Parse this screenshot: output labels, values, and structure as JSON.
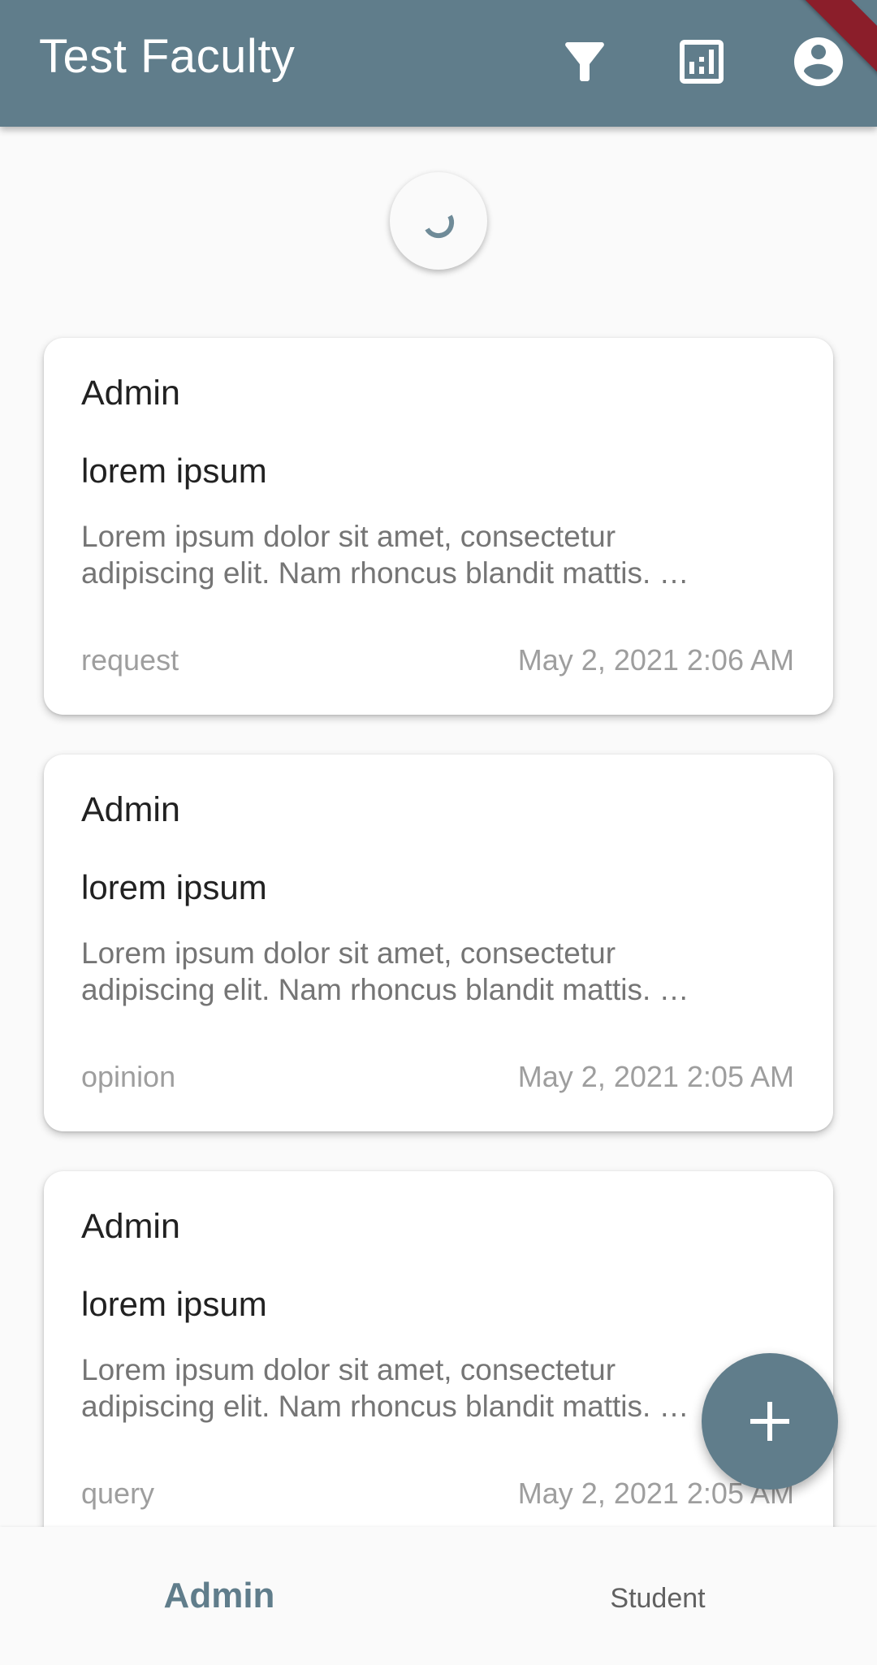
{
  "app_bar": {
    "title": "Test Faculty",
    "actions": [
      {
        "name": "filter-icon"
      },
      {
        "name": "analytics-icon"
      },
      {
        "name": "account-circle-icon"
      }
    ]
  },
  "refresh_indicator": {
    "icon": "loading-spinner-icon"
  },
  "posts": [
    {
      "author": "Admin",
      "title": "lorem ipsum",
      "body_line1": "Lorem ipsum dolor sit amet, consectetur",
      "body_line2": "adipiscing elit. Nam rhoncus blandit mattis. …",
      "type": "request",
      "date": "May 2, 2021 2:06 AM"
    },
    {
      "author": "Admin",
      "title": "lorem ipsum",
      "body_line1": "Lorem ipsum dolor sit amet, consectetur",
      "body_line2": "adipiscing elit. Nam rhoncus blandit mattis. …",
      "type": "opinion",
      "date": "May 2, 2021 2:05 AM"
    },
    {
      "author": "Admin",
      "title": "lorem ipsum",
      "body_line1": "Lorem ipsum dolor sit amet, consectetur",
      "body_line2": "adipiscing elit. Nam rhoncus blandit mattis. …",
      "type": "query",
      "date": "May 2, 2021 2:05 AM"
    }
  ],
  "fab": {
    "icon": "plus-icon"
  },
  "bottom_nav": {
    "items": [
      {
        "label": "Admin",
        "active": true
      },
      {
        "label": "Student",
        "active": false
      }
    ]
  },
  "colors": {
    "primary": "#607d8b",
    "background": "#fafafa",
    "card": "#ffffff",
    "debug_banner": "#8b1e2a"
  }
}
